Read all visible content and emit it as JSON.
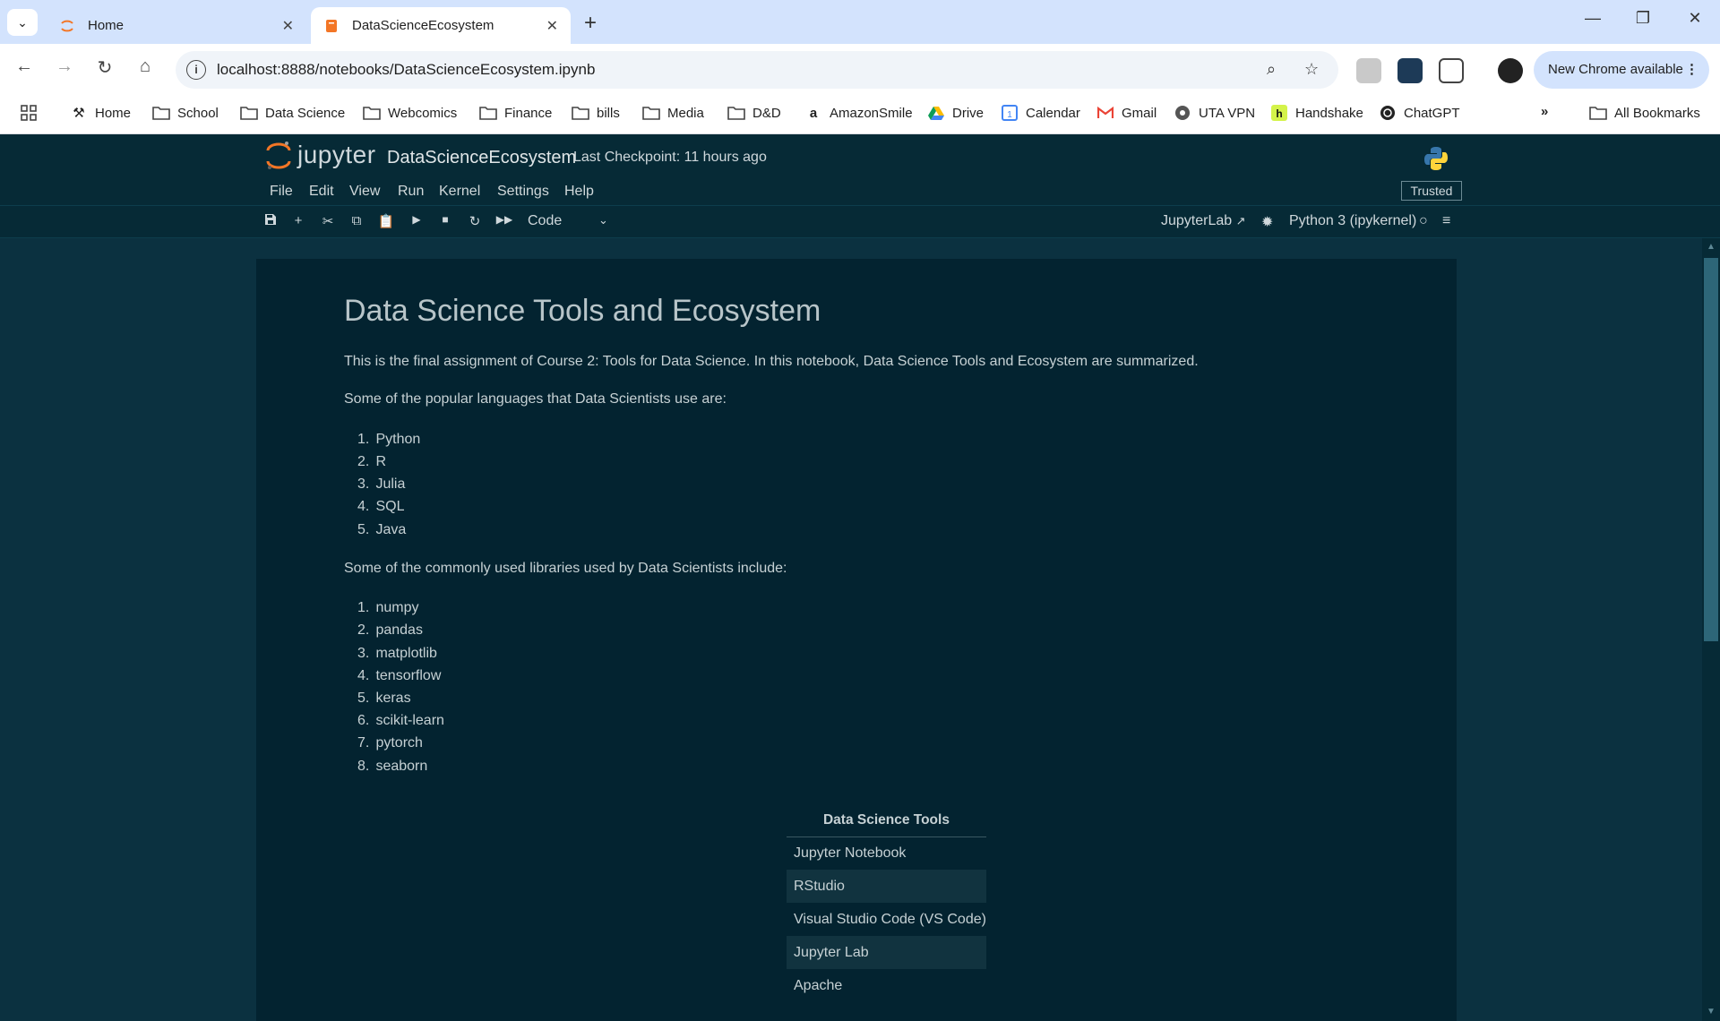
{
  "browser": {
    "tabs": [
      {
        "label": "Home",
        "active": false,
        "icon": "jupyter-icon"
      },
      {
        "label": "DataScienceEcosystem",
        "active": true,
        "icon": "notebook-icon"
      }
    ],
    "new_tab_label": "+",
    "url": "localhost:8888/notebooks/DataScienceEcosystem.ipynb",
    "update_label": "New Chrome available",
    "bookmarks": [
      {
        "label": "Home",
        "icon": "tools-icon"
      },
      {
        "label": "School",
        "icon": "folder-icon"
      },
      {
        "label": "Data Science",
        "icon": "folder-icon"
      },
      {
        "label": "Webcomics",
        "icon": "folder-icon"
      },
      {
        "label": "Finance",
        "icon": "folder-icon"
      },
      {
        "label": "bills",
        "icon": "folder-icon"
      },
      {
        "label": "Media",
        "icon": "folder-icon"
      },
      {
        "label": "D&D",
        "icon": "folder-icon"
      },
      {
        "label": "AmazonSmile",
        "icon": "amazon-icon"
      },
      {
        "label": "Drive",
        "icon": "drive-icon"
      },
      {
        "label": "Calendar",
        "icon": "calendar-icon"
      },
      {
        "label": "Gmail",
        "icon": "gmail-icon"
      },
      {
        "label": "UTA VPN",
        "icon": "globe-icon"
      },
      {
        "label": "Handshake",
        "icon": "handshake-icon"
      },
      {
        "label": "ChatGPT",
        "icon": "chatgpt-icon"
      }
    ],
    "all_bookmarks_label": "All Bookmarks"
  },
  "jupyter": {
    "logo_text": "jupyter",
    "notebook_title": "DataScienceEcosystem",
    "checkpoint": "Last Checkpoint: 11 hours ago",
    "menu": [
      "File",
      "Edit",
      "View",
      "Run",
      "Kernel",
      "Settings",
      "Help"
    ],
    "trusted_label": "Trusted",
    "cell_type": "Code",
    "jupyterlab_label": "JupyterLab",
    "kernel_label": "Python 3 (ipykernel)"
  },
  "notebook": {
    "heading": "Data Science Tools and Ecosystem",
    "intro": "This is the final assignment of Course 2: Tools for Data Science. In this notebook, Data Science Tools and Ecosystem are summarized.",
    "languages_intro": "Some of the popular languages that Data Scientists use are:",
    "languages": [
      "Python",
      "R",
      "Julia",
      "SQL",
      "Java"
    ],
    "libraries_intro": "Some of the commonly used libraries used by Data Scientists include:",
    "libraries": [
      "numpy",
      "pandas",
      "matplotlib",
      "tensorflow",
      "keras",
      "scikit-learn",
      "pytorch",
      "seaborn"
    ],
    "tools_table": {
      "header": "Data Science Tools",
      "rows": [
        "Jupyter Notebook",
        "RStudio",
        "Visual Studio Code (VS Code)",
        "Jupyter Lab",
        "Apache"
      ]
    }
  },
  "colors": {
    "chrome_frame": "#d3e3fd",
    "jupyter_bg": "#062a36",
    "notebook_bg": "#032330",
    "jupyter_orange": "#f37626"
  }
}
